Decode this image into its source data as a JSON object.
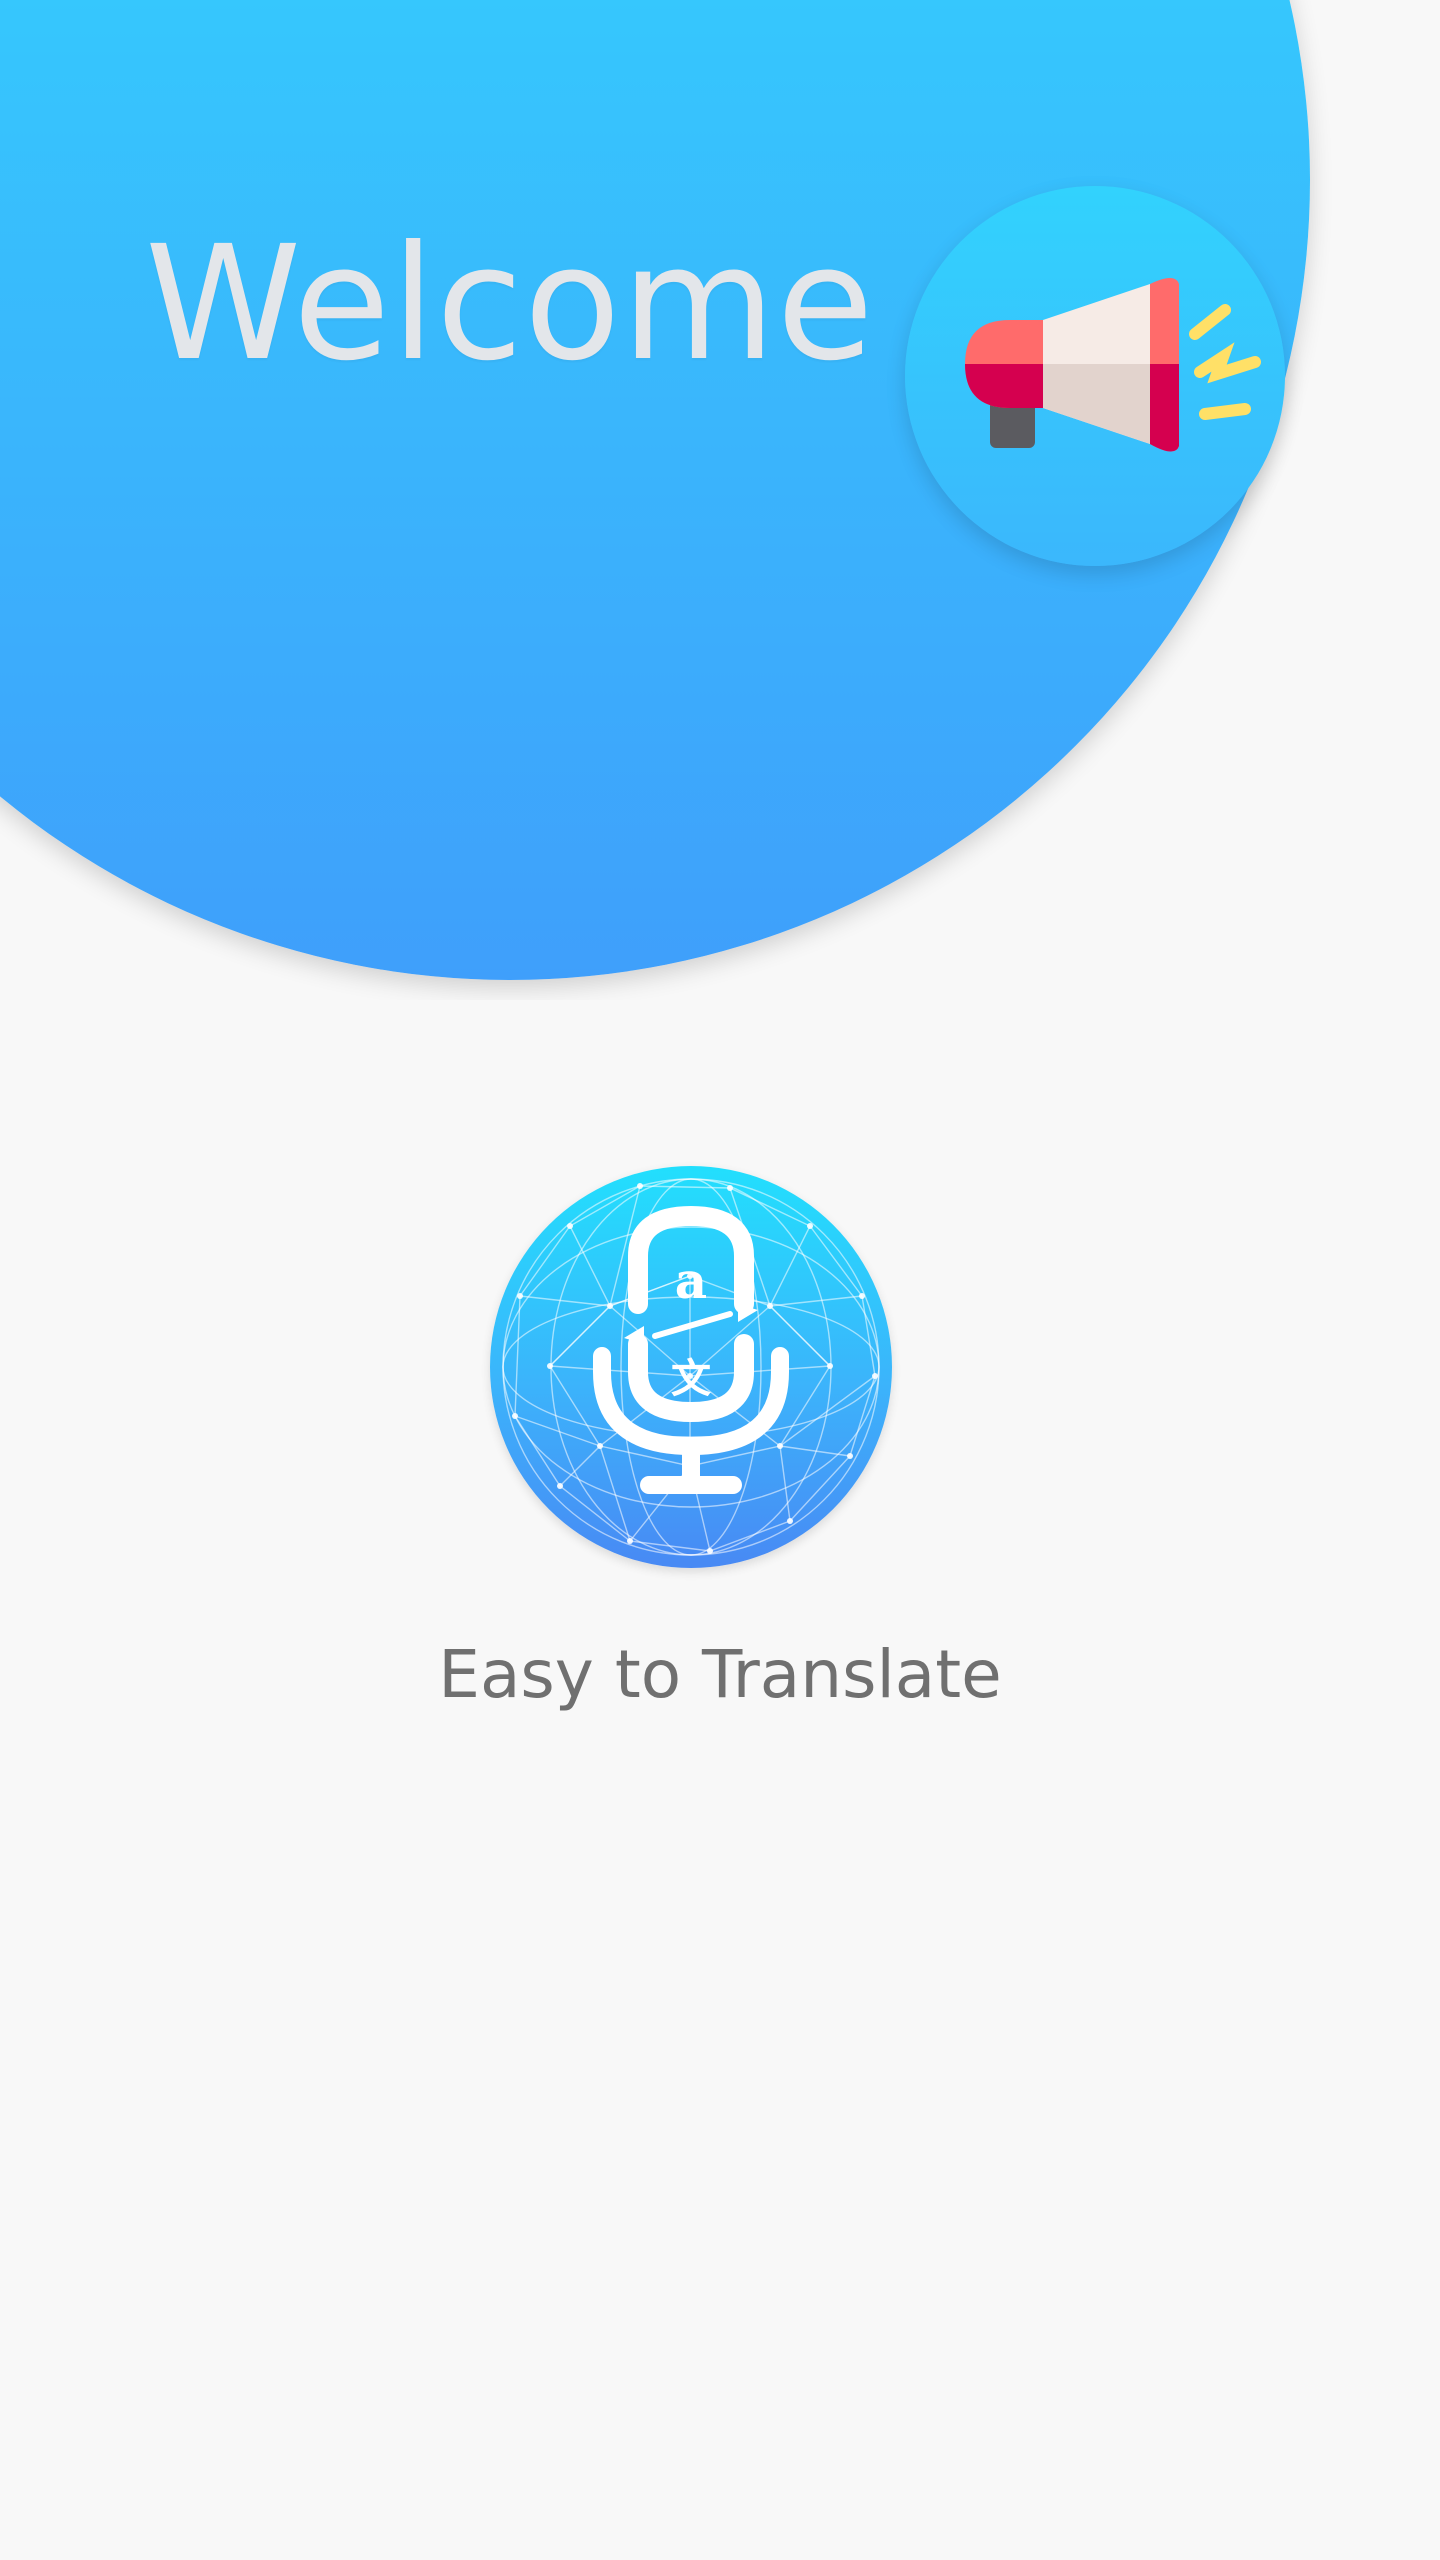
{
  "welcome": {
    "title": "Welcome"
  },
  "logo": {
    "latin_glyph": "a",
    "cjk_glyph": "文",
    "icon": "microphone-translate-icon"
  },
  "tagline": {
    "text": "Easy to Translate"
  },
  "icons": {
    "announcement": "megaphone-icon"
  },
  "colors": {
    "background": "#f8f8f8",
    "gradient_top": "#28e6fd",
    "gradient_bottom": "#3f9ffb",
    "welcome_text": "#e3e6ea",
    "tagline_text": "#707070",
    "megaphone_red": "#ff6b6b",
    "megaphone_dark_red": "#d5004f",
    "megaphone_body": "#f6ebe6",
    "megaphone_handle": "#5b5b60",
    "megaphone_sound": "#ffe067"
  }
}
